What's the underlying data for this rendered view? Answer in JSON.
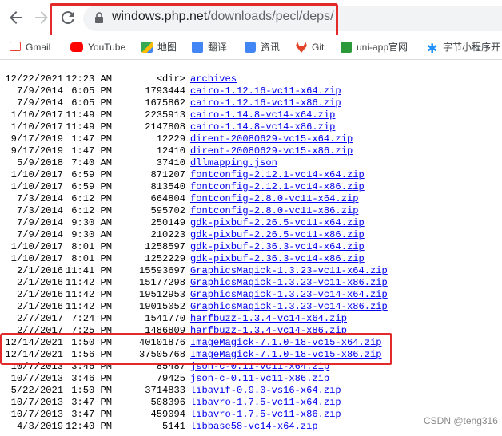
{
  "browser": {
    "url_host": "windows.php.net",
    "url_path": "/downloads/pecl/deps/"
  },
  "bookmarks": [
    {
      "label": "Gmail",
      "icon": "gmail-icon",
      "color": "#ea4335"
    },
    {
      "label": "YouTube",
      "icon": "youtube-icon",
      "color": "#ff0000"
    },
    {
      "label": "地图",
      "icon": "maps-icon",
      "color": "#34a853"
    },
    {
      "label": "翻译",
      "icon": "translate-icon",
      "color": "#4285f4"
    },
    {
      "label": "资讯",
      "icon": "news-icon",
      "color": "#4285f4"
    },
    {
      "label": "Git",
      "icon": "gitlab-icon",
      "color": "#e24329"
    },
    {
      "label": "uni-app官网",
      "icon": "uniapp-icon",
      "color": "#2b9939"
    },
    {
      "label": "字节小程序开",
      "icon": "bytedance-icon",
      "color": "#1f8ffb"
    }
  ],
  "listing": [
    {
      "date": "12/22/2021",
      "time": "12:23 AM",
      "size": "<dir>",
      "name": "archives"
    },
    {
      "date": "7/9/2014",
      "time": "6:05 PM",
      "size": "1793444",
      "name": "cairo-1.12.16-vc11-x64.zip"
    },
    {
      "date": "7/9/2014",
      "time": "6:05 PM",
      "size": "1675862",
      "name": "cairo-1.12.16-vc11-x86.zip"
    },
    {
      "date": "1/10/2017",
      "time": "11:49 PM",
      "size": "2235913",
      "name": "cairo-1.14.8-vc14-x64.zip"
    },
    {
      "date": "1/10/2017",
      "time": "11:49 PM",
      "size": "2147808",
      "name": "cairo-1.14.8-vc14-x86.zip"
    },
    {
      "date": "9/17/2019",
      "time": "1:47 PM",
      "size": "12229",
      "name": "dirent-20080629-vc15-x64.zip"
    },
    {
      "date": "9/17/2019",
      "time": "1:47 PM",
      "size": "12410",
      "name": "dirent-20080629-vc15-x86.zip"
    },
    {
      "date": "5/9/2018",
      "time": "7:40 AM",
      "size": "37410",
      "name": "dllmapping.json"
    },
    {
      "date": "1/10/2017",
      "time": "6:59 PM",
      "size": "871207",
      "name": "fontconfig-2.12.1-vc14-x64.zip"
    },
    {
      "date": "1/10/2017",
      "time": "6:59 PM",
      "size": "813540",
      "name": "fontconfig-2.12.1-vc14-x86.zip"
    },
    {
      "date": "7/3/2014",
      "time": "6:12 PM",
      "size": "664804",
      "name": "fontconfig-2.8.0-vc11-x64.zip"
    },
    {
      "date": "7/3/2014",
      "time": "6:12 PM",
      "size": "595702",
      "name": "fontconfig-2.8.0-vc11-x86.zip"
    },
    {
      "date": "7/9/2014",
      "time": "9:30 AM",
      "size": "250149",
      "name": "gdk-pixbuf-2.26.5-vc11-x64.zip"
    },
    {
      "date": "7/9/2014",
      "time": "9:30 AM",
      "size": "210223",
      "name": "gdk-pixbuf-2.26.5-vc11-x86.zip"
    },
    {
      "date": "1/10/2017",
      "time": "8:01 PM",
      "size": "1258597",
      "name": "gdk-pixbuf-2.36.3-vc14-x64.zip"
    },
    {
      "date": "1/10/2017",
      "time": "8:01 PM",
      "size": "1252229",
      "name": "gdk-pixbuf-2.36.3-vc14-x86.zip"
    },
    {
      "date": "2/1/2016",
      "time": "11:41 PM",
      "size": "15593697",
      "name": "GraphicsMagick-1.3.23-vc11-x64.zip"
    },
    {
      "date": "2/1/2016",
      "time": "11:42 PM",
      "size": "15177298",
      "name": "GraphicsMagick-1.3.23-vc11-x86.zip"
    },
    {
      "date": "2/1/2016",
      "time": "11:42 PM",
      "size": "19512953",
      "name": "GraphicsMagick-1.3.23-vc14-x64.zip"
    },
    {
      "date": "2/1/2016",
      "time": "11:42 PM",
      "size": "19015052",
      "name": "GraphicsMagick-1.3.23-vc14-x86.zip"
    },
    {
      "date": "2/7/2017",
      "time": "7:24 PM",
      "size": "1541770",
      "name": "harfbuzz-1.3.4-vc14-x64.zip"
    },
    {
      "date": "2/7/2017",
      "time": "7:25 PM",
      "size": "1486809",
      "name": "harfbuzz-1.3.4-vc14-x86.zip"
    },
    {
      "date": "12/14/2021",
      "time": "1:50 PM",
      "size": "40101876",
      "name": "ImageMagick-7.1.0-18-vc15-x64.zip"
    },
    {
      "date": "12/14/2021",
      "time": "1:56 PM",
      "size": "37505768",
      "name": "ImageMagick-7.1.0-18-vc15-x86.zip"
    },
    {
      "date": "10/7/2013",
      "time": "3:46 PM",
      "size": "85487",
      "name": "json-c-0.11-vc11-x64.zip"
    },
    {
      "date": "10/7/2013",
      "time": "3:46 PM",
      "size": "79425",
      "name": "json-c-0.11-vc11-x86.zip"
    },
    {
      "date": "5/22/2021",
      "time": "1:50 PM",
      "size": "3714833",
      "name": "libavif-0.9.0-vs16-x64.zip"
    },
    {
      "date": "10/7/2013",
      "time": "3:47 PM",
      "size": "508396",
      "name": "libavro-1.7.5-vc11-x64.zip"
    },
    {
      "date": "10/7/2013",
      "time": "3:47 PM",
      "size": "459094",
      "name": "libavro-1.7.5-vc11-x86.zip"
    },
    {
      "date": "4/3/2019",
      "time": "12:40 PM",
      "size": "5141",
      "name": "libbase58-vc14-x64.zip"
    }
  ],
  "watermark": "CSDN @teng316",
  "annotation_color": "#e32a2a"
}
